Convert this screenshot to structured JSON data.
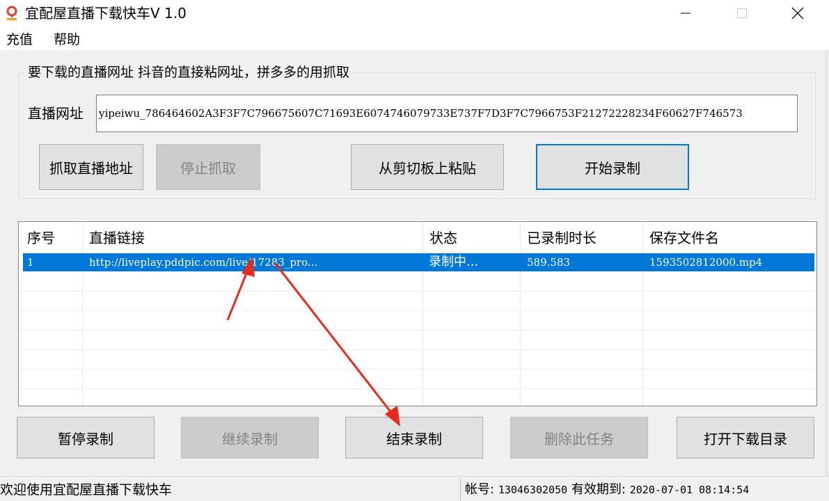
{
  "window": {
    "title": "宜配屋直播下载快车V 1.0",
    "minimize_glyph": "minimize-icon",
    "maximize_glyph": "maximize-icon",
    "close_glyph": "close-icon"
  },
  "menu": [
    {
      "label": "充值"
    },
    {
      "label": "帮助"
    }
  ],
  "group": {
    "legend": "要下载的直播网址 抖音的直接粘网址，拼多多的用抓取",
    "url_label": "直播网址",
    "url_value": "yipeiwu_786464602A3F3F7C796675607C71693E6074746079733E737F7D3F7C7966753F21272228234F60627F746573"
  },
  "buttons_top": {
    "grab": "抓取直播地址",
    "stop_grab": "停止抓取",
    "paste": "从剪切板上粘贴",
    "start": "开始录制"
  },
  "table": {
    "columns": [
      "序号",
      "直播链接",
      "状态",
      "已录制时长",
      "保存文件名"
    ],
    "rows": [
      {
        "index": "1",
        "url": "http://liveplay.pddpic.com/live/17283_pro...",
        "status": "录制中...",
        "duration": "589.583",
        "filename": "1593502812000.mp4"
      }
    ]
  },
  "buttons_bottom": {
    "pause": "暂停录制",
    "resume": "继续录制",
    "end": "结束录制",
    "delete": "删除此任务",
    "open_dir": "打开下载目录"
  },
  "status": {
    "welcome": "欢迎使用宜配屋直播下载快车",
    "account_label": "帐号:",
    "account": "13046302050",
    "valid_label": "有效期到:",
    "valid_until": "2020-07-01 08:14:54"
  },
  "colors": {
    "selection": "#0078d7",
    "arrow": "#e8291c",
    "accent_border": "#0078d7"
  }
}
